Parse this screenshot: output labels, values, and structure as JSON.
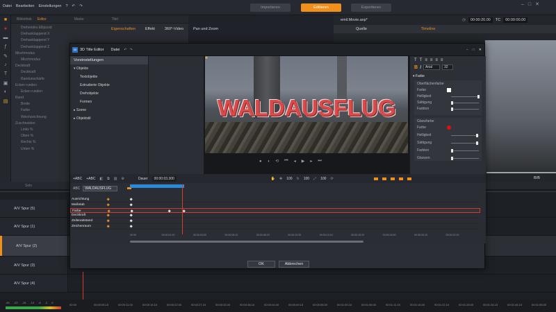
{
  "menu": [
    "Datei",
    "Bearbeiten",
    "Einstellungen"
  ],
  "top_tabs": {
    "import": "Importieren",
    "edit": "Editieren",
    "export": "Exportieren"
  },
  "colors": {
    "accent": "#f0901a",
    "selection": "#d33a2a",
    "marker": "#e03a2a"
  },
  "left_panel": {
    "tabs": [
      "Bibliothek",
      "Editor",
      "Marke",
      "Titel"
    ],
    "items": [
      "Drehendes Ellipsoid",
      "Drehanklappend X",
      "Drehanklappend Y",
      "Drehanklappend Z",
      "Mischmodus",
      "Mischmodus",
      "Deckkraft",
      "Deckkraft",
      "Randunschärfe",
      "Ecken runden",
      "Ecken runden",
      "Rand",
      "Breite",
      "Farbe",
      "Weichzeichnung",
      "Zuschneiden",
      "Links %",
      "Oben %",
      "Rechts %",
      "Unten %"
    ]
  },
  "props_tabs": [
    "Eigenschaften",
    "Effekt",
    "360°-Video",
    "Pan und Zoom"
  ],
  "right_panel": {
    "file": "emil.Movie.axp*",
    "time": "00:00:20.00",
    "tc_label": "TC",
    "tc": "00:00:00.00",
    "tab_source": "Quelle",
    "tab_timeline": "Timeline",
    "zoom": "B/B"
  },
  "editor": {
    "title": "3D Title Editor",
    "file_menu": "Datei",
    "presets": "Voreinstellungen",
    "tree": [
      "Objekte",
      "Textobjekte",
      "Extrudierte Objekte",
      "Drehobjekte",
      "Formen",
      "Szene",
      "Objektstil"
    ],
    "title_text": "WALDAUSFLUG",
    "duration_label": "Dauer",
    "duration": "00:00:03.300",
    "kf_layer_label": "ABC",
    "kf_layer": "WALDAUSFLUG",
    "kf_values": [
      "100",
      "100",
      "100"
    ],
    "kf_rows": [
      "Ausrichtung",
      "Maßstab",
      "Farbe",
      "Deckkraft",
      "Zeilenabstand",
      "Zeichenraum"
    ],
    "ruler": [
      "00:00",
      "00:00:01:20",
      "00:00:04:00",
      "00:00:06:10",
      "00:00:08:20",
      "00:00:10:30",
      "00:00:13:10",
      "00:00:15:20",
      "00:00:18:00",
      "00:00:20:10",
      "00:00:22:20"
    ],
    "ok": "OK",
    "cancel": "Abbrechen",
    "font": "Arial",
    "font_size": "32",
    "props": {
      "color_section": "Farbe",
      "surface": "Oberflächenfarbe",
      "color": "Farbe",
      "brightness": "Helligkeit",
      "saturation": "Sättigung",
      "hue": "Farbton",
      "gloss": "Glanzfarbe",
      "color2": "Farbe",
      "brightness2": "Helligkeit",
      "saturation2": "Sättigung",
      "hue2": "Farbton",
      "shine": "Glanzen"
    }
  },
  "timeline": {
    "solo": "Solo",
    "tracks": [
      "A/V Spur (5)",
      "A/V Spur (1)",
      "A/V Spur (2)",
      "A/V Spur (3)",
      "A/V Spur (4)"
    ],
    "ruler": [
      "00:00",
      "00:00:05.15",
      "00:00:11.00",
      "00:00:16.15",
      "00:00:22.00",
      "00:00:27.15",
      "00:00:33.00",
      "00:00:38.15",
      "00:00:44.00",
      "00:00:49.15",
      "00:00:55.00",
      "00:01:00.15",
      "00:01:06.00",
      "00:01:11.15",
      "00:01:16.00",
      "00:01:22.15",
      "00:01:28.00",
      "00:01:34.15",
      "00:01:45.15",
      "00:01:55.00"
    ],
    "meter": [
      "-60",
      "-22",
      "-16",
      "-10",
      "-6",
      "-3",
      "0"
    ]
  }
}
